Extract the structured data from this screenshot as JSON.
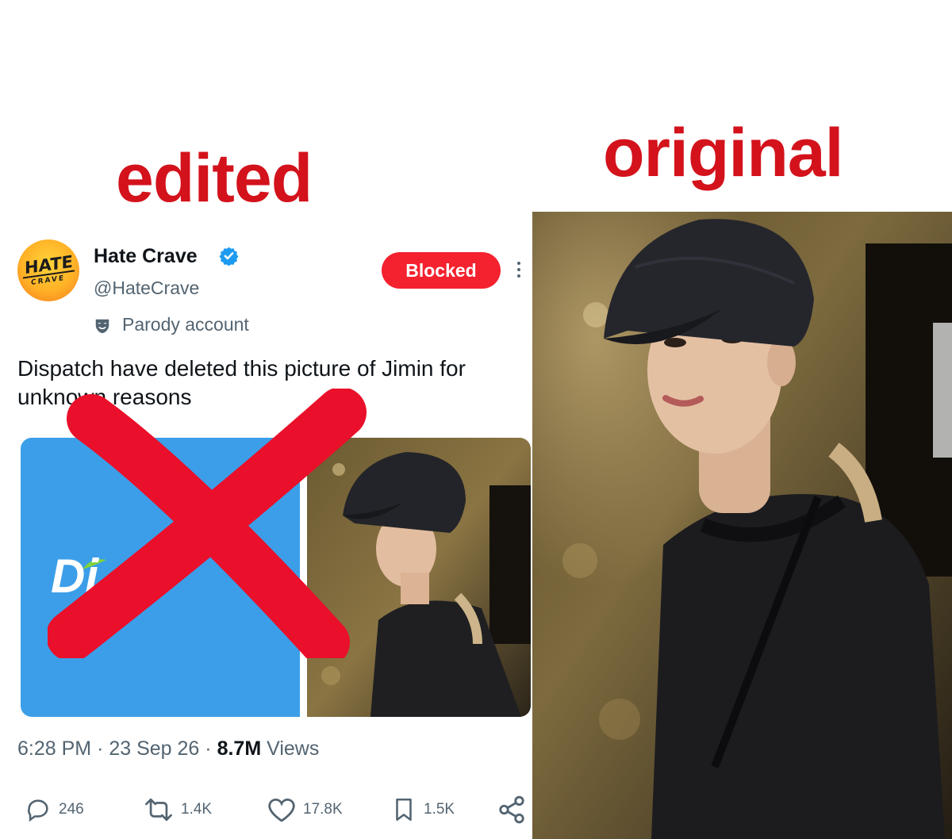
{
  "labels": {
    "edited": "edited",
    "original": "original"
  },
  "tweet": {
    "avatar_line1": "HATE",
    "avatar_line2": "CRAVE",
    "display_name": "Hate Crave",
    "handle": "@HateCrave",
    "blocked_label": "Blocked",
    "parody_label": "Parody account",
    "text": "Dispatch have deleted this picture of Jimin for unknown reasons",
    "media_logo_text": "Di",
    "time": "6:28 PM",
    "sep": "·",
    "date": "23 Sep 26",
    "views_count": "8.7M",
    "views_label": "Views",
    "actions": {
      "replies": "246",
      "reposts": "1.4K",
      "likes": "17.8K",
      "bookmarks": "1.5K"
    }
  },
  "colors": {
    "accent_red": "#d3121c",
    "blocked_red": "#f4212e",
    "verified_blue": "#1d9bf0",
    "dispatch_blue": "#3c9ee8"
  }
}
